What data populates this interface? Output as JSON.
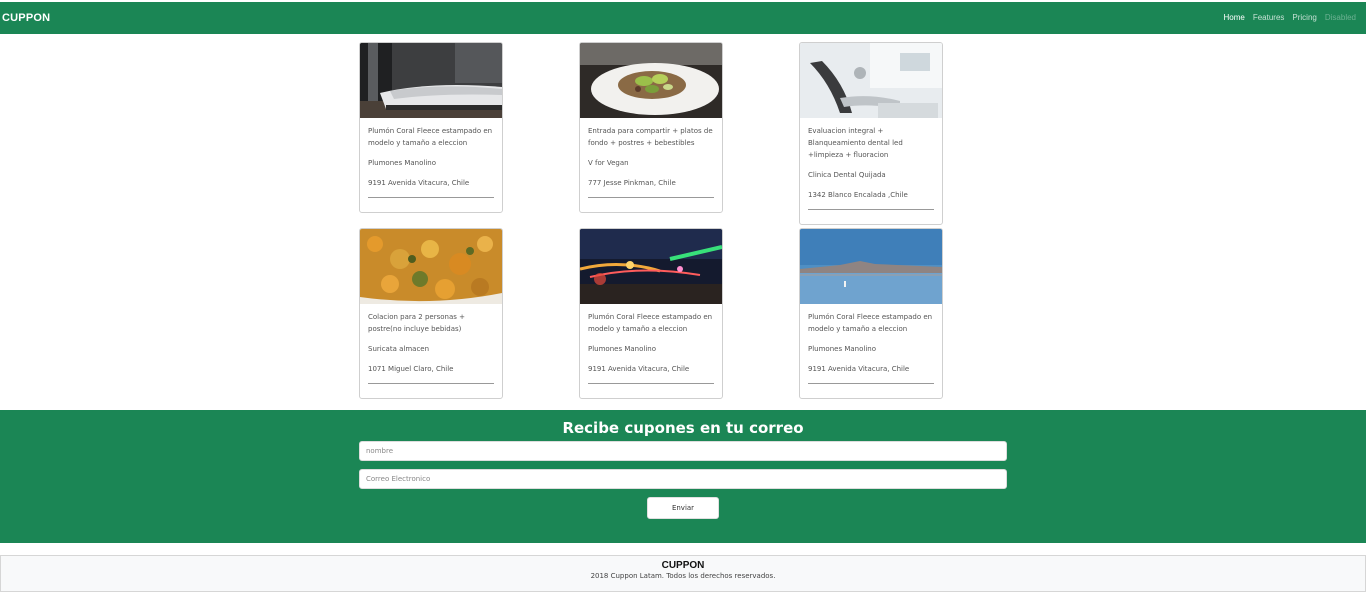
{
  "navbar": {
    "brand": "CUPPON",
    "links": [
      {
        "label": "Home",
        "state": "active"
      },
      {
        "label": "Features",
        "state": "normal"
      },
      {
        "label": "Pricing",
        "state": "normal"
      },
      {
        "label": "Disabled",
        "state": "disabled"
      }
    ]
  },
  "cards": [
    {
      "image": "bedroom-photo",
      "title": "Plumón Coral Fleece estampado en modelo y tamaño a eleccion",
      "company": "Plumones Manolino",
      "address": "9191 Avenida Vitacura, Chile"
    },
    {
      "image": "salad-plate-photo",
      "title": "Entrada para compartir + platos de fondo + postres + bebestibles",
      "company": "V for Vegan",
      "address": "777 Jesse Pinkman, Chile"
    },
    {
      "image": "dental-chair-photo",
      "title": "Evaluacion integral + Blanqueamiento dental led +limpieza + fluoracion",
      "company": "Clinica Dental Quijada",
      "address": "1342 Blanco Encalada ,Chile"
    },
    {
      "image": "stew-photo",
      "title": "Colacion para 2 personas + postre(no incluye bebidas)",
      "company": "Suricata almacen",
      "address": "1071 Miguel Claro, Chile"
    },
    {
      "image": "night-carnival-photo",
      "title": "Plumón Coral Fleece estampado en modelo y tamaño a eleccion",
      "company": "Plumones Manolino",
      "address": "9191 Avenida Vitacura, Chile"
    },
    {
      "image": "salt-lake-photo",
      "title": "Plumón Coral Fleece estampado en modelo y tamaño a eleccion",
      "company": "Plumones Manolino",
      "address": "9191 Avenida Vitacura, Chile"
    }
  ],
  "newsletter": {
    "heading": "Recibe cupones en tu correo",
    "name_placeholder": "nombre",
    "email_placeholder": "Correo Electronico",
    "submit_label": "Enviar"
  },
  "footer": {
    "brand": "CUPPON",
    "copyright": "2018 Cuppon Latam. Todos los derechos reservados."
  },
  "colors": {
    "brand_green": "#1b8655"
  }
}
